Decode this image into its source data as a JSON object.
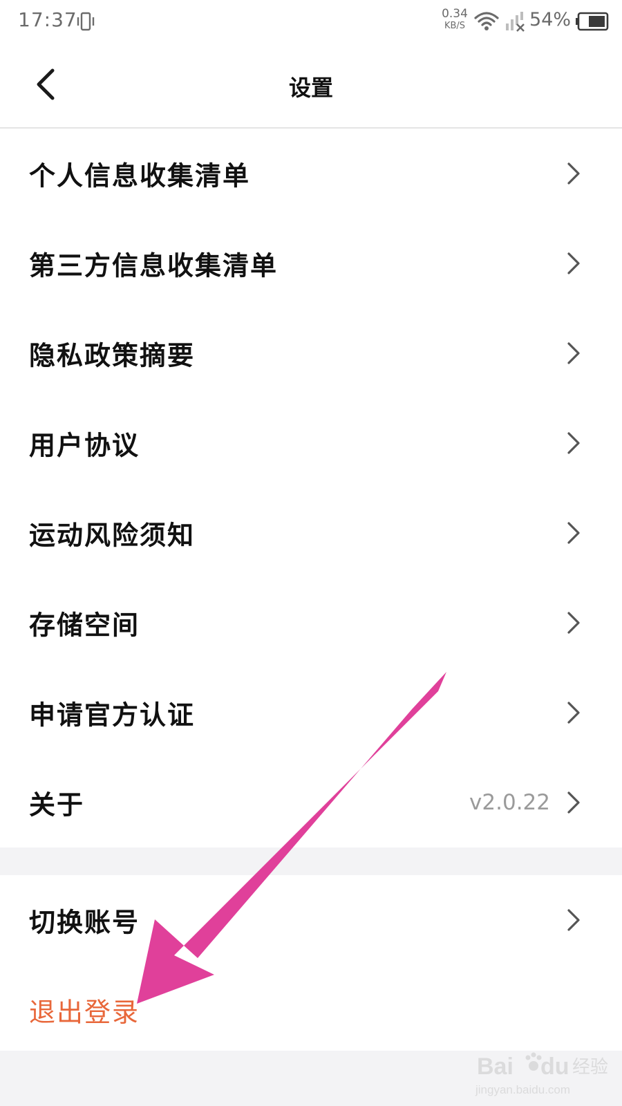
{
  "status_bar": {
    "time": "17:37",
    "net_speed_value": "0.34",
    "net_speed_unit": "KB/S",
    "battery_percent": "54%"
  },
  "header": {
    "title": "设置"
  },
  "settings": {
    "items": [
      {
        "label": "个人信息收集清单",
        "value": ""
      },
      {
        "label": "第三方信息收集清单",
        "value": ""
      },
      {
        "label": "隐私政策摘要",
        "value": ""
      },
      {
        "label": "用户协议",
        "value": ""
      },
      {
        "label": "运动风险须知",
        "value": ""
      },
      {
        "label": "存储空间",
        "value": ""
      },
      {
        "label": "申请官方认证",
        "value": ""
      },
      {
        "label": "关于",
        "value": "v2.0.22"
      }
    ],
    "switch_account": "切换账号",
    "logout": "退出登录"
  },
  "colors": {
    "logout_text": "#e8673a",
    "annotation_arrow": "#e0409a",
    "section_gap": "#f3f3f5"
  },
  "icons": {
    "back": "chevron-left-icon",
    "row": "chevron-right-icon",
    "vibrate": "vibrate-icon",
    "wifi": "wifi-icon",
    "signal": "signal-icon",
    "battery": "battery-icon"
  },
  "watermark": {
    "brand": "Bai",
    "brand_suffix": "du",
    "product": "经验",
    "url": "jingyan.baidu.com"
  }
}
